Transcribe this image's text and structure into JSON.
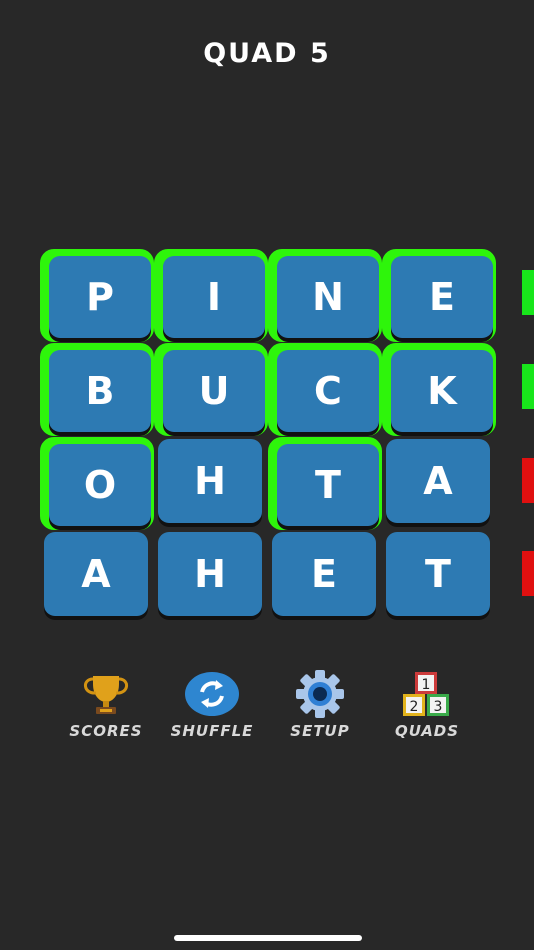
{
  "header": {
    "title": "QUAD 5"
  },
  "board": {
    "rows": [
      {
        "status_color": "#18e61b",
        "cells": [
          {
            "letter": "P",
            "highlighted": true
          },
          {
            "letter": "I",
            "highlighted": true
          },
          {
            "letter": "N",
            "highlighted": true
          },
          {
            "letter": "E",
            "highlighted": true
          }
        ]
      },
      {
        "status_color": "#18e61b",
        "cells": [
          {
            "letter": "B",
            "highlighted": true
          },
          {
            "letter": "U",
            "highlighted": true
          },
          {
            "letter": "C",
            "highlighted": true
          },
          {
            "letter": "K",
            "highlighted": true
          }
        ]
      },
      {
        "status_color": "#e01010",
        "cells": [
          {
            "letter": "O",
            "highlighted": true
          },
          {
            "letter": "H",
            "highlighted": false
          },
          {
            "letter": "T",
            "highlighted": true
          },
          {
            "letter": "A",
            "highlighted": false
          }
        ]
      },
      {
        "status_color": "#e01010",
        "cells": [
          {
            "letter": "A",
            "highlighted": false
          },
          {
            "letter": "H",
            "highlighted": false
          },
          {
            "letter": "E",
            "highlighted": false
          },
          {
            "letter": "T",
            "highlighted": false
          }
        ]
      }
    ],
    "tile_color": "#2d7ab3",
    "highlight_color": "#2ef50b"
  },
  "toolbar": {
    "scores": {
      "label": "SCORES",
      "icon": "trophy-icon"
    },
    "shuffle": {
      "label": "SHUFFLE",
      "icon": "shuffle-icon"
    },
    "setup": {
      "label": "SETUP",
      "icon": "gear-icon"
    },
    "quads": {
      "label": "QUADS",
      "icon": "number-blocks-icon",
      "block_numbers": [
        "1",
        "2",
        "3"
      ]
    }
  }
}
